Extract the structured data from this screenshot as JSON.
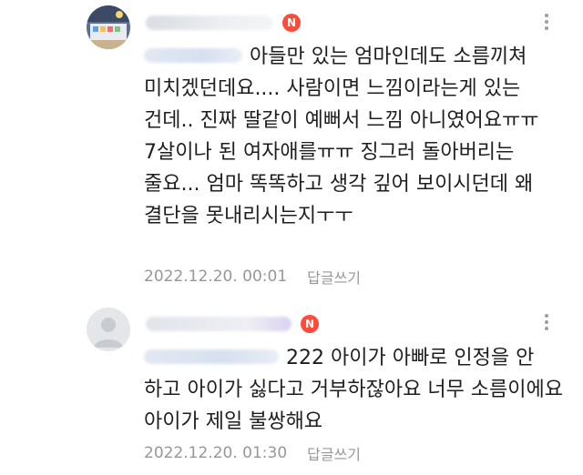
{
  "comments": [
    {
      "body": "아들만 있는 엄마인데도 소름끼쳐 미치겠던데요.... 사람이면 느낌이라는게 있는 건데.. 진짜 딸같이 예뻐서 느낌 아니였어요ㅠㅠ 7살이나 된 여자애를ㅠㅠ 징그러 돌아버리는 줄요... 엄마 똑똑하고 생각 깊어 보이시던데 왜 결단을 못내리시는지ㅜㅜ",
      "timestamp": "2022.12.20. 00:01",
      "reply_label": "답글쓰기",
      "badge": "N"
    },
    {
      "body": "222 아이가 아빠로 인정을 안 하고 아이가 싫다고 거부하잖아요 너무 소름이에요 아이가 제일 불쌍해요",
      "timestamp": "2022.12.20. 01:30",
      "reply_label": "답글쓰기",
      "badge": "N"
    }
  ],
  "colors": {
    "badge": "#ff4b3a",
    "meta_text": "#979797",
    "body_text": "#1e1e1e"
  },
  "icons": {
    "more": "more-vertical-icon",
    "default_avatar": "default-profile-avatar"
  }
}
